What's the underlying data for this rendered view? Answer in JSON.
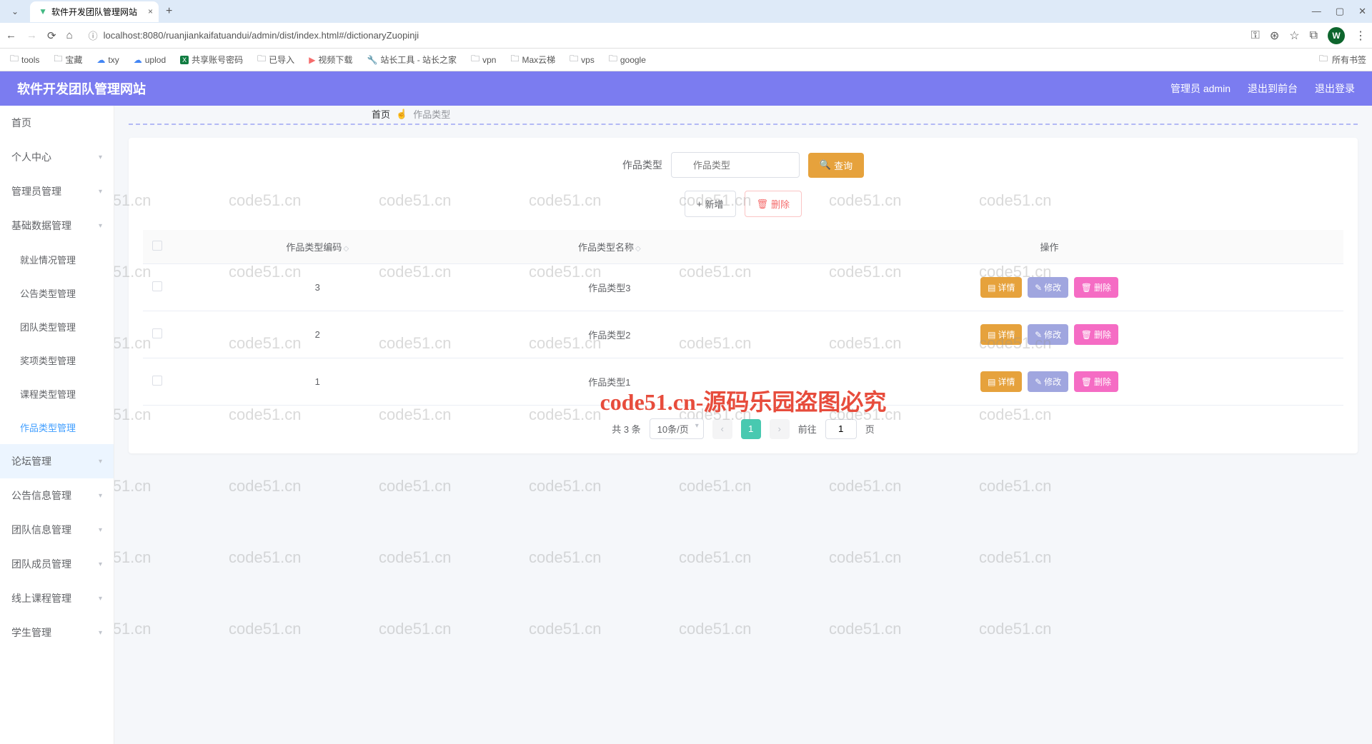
{
  "browser": {
    "tab_title": "软件开发团队管理网站",
    "url": "localhost:8080/ruanjiankaifatuandui/admin/dist/index.html#/dictionaryZuopinji",
    "bookmarks": [
      "tools",
      "宝藏",
      "txy",
      "uplod",
      "共享账号密码",
      "已导入",
      "视频下载",
      "站长工具 - 站长之家",
      "vpn",
      "Max云梯",
      "vps",
      "google"
    ],
    "all_bookmarks": "所有书签",
    "profile_letter": "W"
  },
  "header": {
    "title": "软件开发团队管理网站",
    "user": "管理员 admin",
    "logout_front": "退出到前台",
    "logout": "退出登录"
  },
  "sidebar": {
    "items": [
      {
        "label": "首页",
        "type": "item"
      },
      {
        "label": "个人中心",
        "type": "expand"
      },
      {
        "label": "管理员管理",
        "type": "expand"
      },
      {
        "label": "基础数据管理",
        "type": "expand"
      },
      {
        "label": "就业情况管理",
        "type": "sub"
      },
      {
        "label": "公告类型管理",
        "type": "sub"
      },
      {
        "label": "团队类型管理",
        "type": "sub"
      },
      {
        "label": "奖项类型管理",
        "type": "sub"
      },
      {
        "label": "课程类型管理",
        "type": "sub"
      },
      {
        "label": "作品类型管理",
        "type": "sub",
        "active": true
      },
      {
        "label": "论坛管理",
        "type": "expand",
        "hover": true
      },
      {
        "label": "公告信息管理",
        "type": "expand"
      },
      {
        "label": "团队信息管理",
        "type": "expand"
      },
      {
        "label": "团队成员管理",
        "type": "expand"
      },
      {
        "label": "线上课程管理",
        "type": "expand"
      },
      {
        "label": "学生管理",
        "type": "expand"
      }
    ]
  },
  "breadcrumb": {
    "home": "首页",
    "current": "作品类型"
  },
  "search": {
    "label": "作品类型",
    "placeholder": "作品类型",
    "query_btn": "查询"
  },
  "actions": {
    "add": "新增",
    "delete": "删除"
  },
  "table": {
    "headers": [
      "作品类型编码",
      "作品类型名称",
      "操作"
    ],
    "rows": [
      {
        "code": "3",
        "name": "作品类型3"
      },
      {
        "code": "2",
        "name": "作品类型2"
      },
      {
        "code": "1",
        "name": "作品类型1"
      }
    ],
    "row_actions": {
      "detail": "详情",
      "edit": "修改",
      "delete": "删除"
    }
  },
  "pagination": {
    "total": "共 3 条",
    "page_size": "10条/页",
    "current": "1",
    "goto_label": "前往",
    "goto_value": "1",
    "page_suffix": "页"
  },
  "watermark": {
    "text": "code51.cn",
    "big": "code51.cn-源码乐园盗图必究"
  }
}
